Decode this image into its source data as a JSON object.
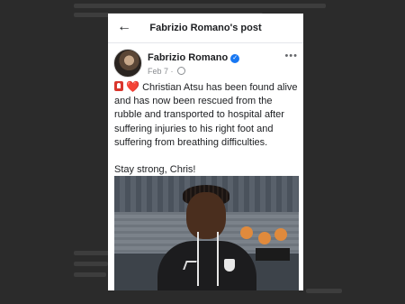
{
  "topbar": {
    "back_icon": "arrow-left-icon",
    "title": "Fabrizio Romano's post"
  },
  "post": {
    "author": "Fabrizio Romano",
    "verified": true,
    "date": "Feb 7 ·",
    "audience_icon": "globe-icon",
    "more_icon": "more-dots-icon",
    "emoji_1": "alarm-emoji-icon",
    "emoji_2": "❤️",
    "text": "Christian Atsu has been found alive and has now been rescued from the rubble and transported to hospital after suffering injuries to his right foot and suffering from breathing difficulties.",
    "closing": "Stay strong, Chris!",
    "photo": "player-photo"
  },
  "colors": {
    "verified": "#1877f2",
    "heart": "#e0245e",
    "alarm": "#d9352c"
  }
}
